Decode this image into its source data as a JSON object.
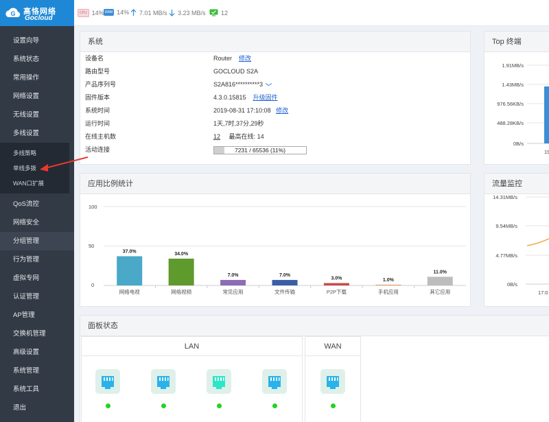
{
  "header": {
    "logo_cn": "高恪网络",
    "logo_en": "Gocloud",
    "stats": [
      {
        "icon": "cpu-icon",
        "badge": "CPU",
        "value": "14%"
      },
      {
        "icon": "ram-icon",
        "badge": "RAM",
        "value": "14%"
      },
      {
        "icon": "upload-arrow-icon",
        "value": "7.01 MB/s"
      },
      {
        "icon": "download-arrow-icon",
        "value": "3.23 MB/s"
      },
      {
        "icon": "online-device-icon",
        "value": "12"
      }
    ]
  },
  "sidebar": {
    "items": [
      {
        "label": "设置向导"
      },
      {
        "label": "系统状态"
      },
      {
        "label": "常用操作"
      },
      {
        "label": "网络设置"
      },
      {
        "label": "无线设置"
      },
      {
        "label": "多线设置"
      }
    ],
    "subitems": [
      {
        "label": "多线策略"
      },
      {
        "label": "单线多拨"
      },
      {
        "label": "WAN口扩展"
      }
    ],
    "items2": [
      {
        "label": "QoS流控"
      },
      {
        "label": "网络安全"
      },
      {
        "label": "分组管理"
      },
      {
        "label": "行为管理"
      },
      {
        "label": "虚拟专网"
      },
      {
        "label": "认证管理"
      },
      {
        "label": "AP管理"
      },
      {
        "label": "交换机管理"
      },
      {
        "label": "高级设置"
      },
      {
        "label": "系统管理"
      },
      {
        "label": "系统工具"
      },
      {
        "label": "退出"
      }
    ]
  },
  "system": {
    "title": "系统",
    "rows": [
      {
        "key": "设备名",
        "value": "Router",
        "link": "修改"
      },
      {
        "key": "路由型号",
        "value": "GOCLOUD S2A"
      },
      {
        "key": "产品序列号",
        "value": "S2A816**********3"
      },
      {
        "key": "固件版本",
        "value": "4.3.0.15815",
        "link": "升级固件"
      },
      {
        "key": "系统时间",
        "value": "2019-08-31 17:10:08",
        "link": "修改"
      },
      {
        "key": "运行时间",
        "value": "1天,7时,37分,29秒"
      },
      {
        "key": "在线主机数",
        "value": "12",
        "extra_label": "最高在线:",
        "extra_value": "14"
      },
      {
        "key": "活动连接",
        "value": "7231 / 65536 (11%)",
        "fraction": 0.11
      }
    ]
  },
  "top_terminal": {
    "title": "Top 终端",
    "yticks": [
      "1.91MB/s",
      "1.43MB/s",
      "976.56KB/s",
      "488.28KB/s",
      "0B/s"
    ],
    "xlabel_partial": "19"
  },
  "flow": {
    "title": "流量监控",
    "yticks": [
      "14.31MB/s",
      "9.54MB/s",
      "4.77MB/s",
      "0B/s"
    ],
    "xlabel_partial": "17:0"
  },
  "app_stats": {
    "title": "应用比例统计"
  },
  "chart_data": {
    "type": "bar",
    "categories": [
      "网络电视",
      "网络视频",
      "常见应用",
      "文件传输",
      "P2P下载",
      "手机应用",
      "其它应用"
    ],
    "values": [
      37.0,
      34.0,
      7.0,
      7.0,
      3.0,
      1.0,
      11.0
    ],
    "data_labels": [
      "37.0%",
      "34.0%",
      "7.0%",
      "7.0%",
      "3.0%",
      "1.0%",
      "11.0%"
    ],
    "colors": [
      "#4aa8c8",
      "#5f9a2c",
      "#8d6cb6",
      "#3b5fa6",
      "#c84a4a",
      "#e8a06a",
      "#bdbdbd"
    ],
    "yticks": [
      "100",
      "50",
      "0"
    ],
    "ylim": [
      0,
      100
    ],
    "grid": true
  },
  "panel_state": {
    "title": "面板状态",
    "lan_label": "LAN",
    "wan_label": "WAN",
    "lan_port_colors": [
      "#2ab3e8",
      "#2ab3e8",
      "#2ce6c9",
      "#2ab3e8"
    ],
    "wan_port_color": "#2ab3e8"
  }
}
